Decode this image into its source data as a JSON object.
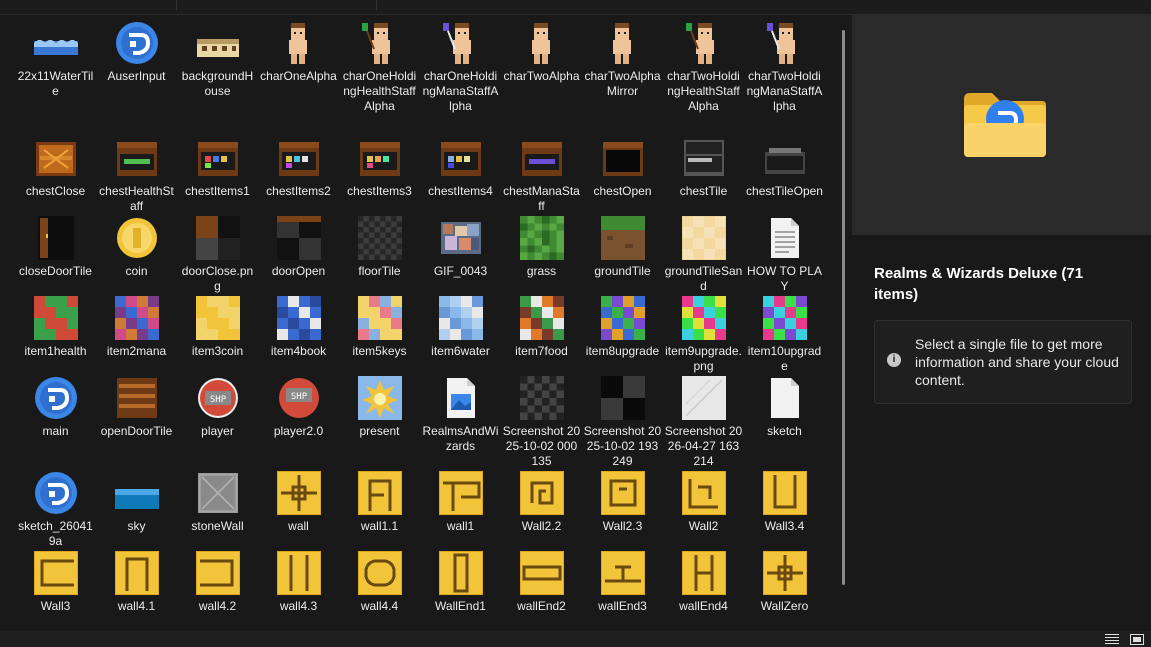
{
  "details": {
    "title": "Realms & Wizards Deluxe (71 items)",
    "info_message": "Select a single file to get more information and share your cloud content.",
    "info_icon": "i"
  },
  "files": [
    {
      "name": "22x11WaterTile",
      "icon": "water-tile-icon"
    },
    {
      "name": "AuserInput",
      "icon": "app-blue-icon"
    },
    {
      "name": "backgroundHouse",
      "icon": "house-icon"
    },
    {
      "name": "charOneAlpha",
      "icon": "character-icon"
    },
    {
      "name": "charOneHoldingHealthStaffAlpha",
      "icon": "character-health-staff-icon"
    },
    {
      "name": "charOneHoldingManaStaffAlpha",
      "icon": "character-mana-staff-icon"
    },
    {
      "name": "charTwoAlpha",
      "icon": "character-icon"
    },
    {
      "name": "charTwoAlphaMirror",
      "icon": "character-icon"
    },
    {
      "name": "charTwoHoldingHealthStaffAlpha",
      "icon": "character-health-staff-icon"
    },
    {
      "name": "charTwoHoldingManaStaffAlpha",
      "icon": "character-mana-staff-icon"
    },
    {
      "name": "chestClose",
      "icon": "chest-closed-icon"
    },
    {
      "name": "chestHealthStaff",
      "icon": "chest-health-icon"
    },
    {
      "name": "chestItems1",
      "icon": "chest-items-icon"
    },
    {
      "name": "chestItems2",
      "icon": "chest-items-icon"
    },
    {
      "name": "chestItems3",
      "icon": "chest-items-icon"
    },
    {
      "name": "chestItems4",
      "icon": "chest-items-icon"
    },
    {
      "name": "chestManaStaff",
      "icon": "chest-mana-icon"
    },
    {
      "name": "chestOpen",
      "icon": "chest-open-icon"
    },
    {
      "name": "chestTile",
      "icon": "chest-tile-icon"
    },
    {
      "name": "chestTileOpen",
      "icon": "chest-tile-open-icon"
    },
    {
      "name": "closeDoorTile",
      "icon": "door-closed-icon"
    },
    {
      "name": "coin",
      "icon": "coin-icon"
    },
    {
      "name": "doorClose.png",
      "icon": "door-tile-icon"
    },
    {
      "name": "doorOpen",
      "icon": "door-open-icon"
    },
    {
      "name": "floorTile",
      "icon": "checker-icon"
    },
    {
      "name": "GIF_0043",
      "icon": "photo-icon"
    },
    {
      "name": "grass",
      "icon": "grass-icon"
    },
    {
      "name": "groundTile",
      "icon": "ground-icon"
    },
    {
      "name": "groundTileSand",
      "icon": "sand-icon"
    },
    {
      "name": "HOW TO PLAY",
      "icon": "text-document-icon"
    },
    {
      "name": "item1health",
      "icon": "item-grid-icon"
    },
    {
      "name": "item2mana",
      "icon": "item-grid-icon"
    },
    {
      "name": "item3coin",
      "icon": "item-grid-icon"
    },
    {
      "name": "item4book",
      "icon": "item-grid-icon"
    },
    {
      "name": "item5keys",
      "icon": "item-grid-icon"
    },
    {
      "name": "item6water",
      "icon": "item-grid-icon"
    },
    {
      "name": "item7food",
      "icon": "item-grid-icon"
    },
    {
      "name": "item8upgrade",
      "icon": "item-grid-icon"
    },
    {
      "name": "item9upgrade.png",
      "icon": "item-grid-icon"
    },
    {
      "name": "item10upgrade",
      "icon": "item-grid-icon"
    },
    {
      "name": "main",
      "icon": "app-blue-icon"
    },
    {
      "name": "openDoorTile",
      "icon": "door-open-tile-icon"
    },
    {
      "name": "player",
      "icon": "player-icon"
    },
    {
      "name": "player2.0",
      "icon": "player2-icon"
    },
    {
      "name": "present",
      "icon": "present-icon"
    },
    {
      "name": "RealmsAndWizards",
      "icon": "image-file-icon"
    },
    {
      "name": "Screenshot 2025-10-02 000135",
      "icon": "screenshot-checker-icon"
    },
    {
      "name": "Screenshot 2025-10-02 193249",
      "icon": "screenshot-blocks-icon"
    },
    {
      "name": "Screenshot 2026-04-27 163214",
      "icon": "screenshot-light-icon"
    },
    {
      "name": "sketch",
      "icon": "blank-document-icon"
    },
    {
      "name": "sketch_260419a",
      "icon": "app-blue-icon"
    },
    {
      "name": "sky",
      "icon": "sky-icon"
    },
    {
      "name": "stoneWall",
      "icon": "stone-wall-icon"
    },
    {
      "name": "wall",
      "icon": "wall-icon"
    },
    {
      "name": "wall1.1",
      "icon": "wall-icon"
    },
    {
      "name": "wall1",
      "icon": "wall-icon"
    },
    {
      "name": "Wall2.2",
      "icon": "wall-icon"
    },
    {
      "name": "Wall2.3",
      "icon": "wall-icon"
    },
    {
      "name": "Wall2",
      "icon": "wall-icon"
    },
    {
      "name": "Wall3.4",
      "icon": "wall-icon"
    },
    {
      "name": "Wall3",
      "icon": "wall-icon"
    },
    {
      "name": "wall4.1",
      "icon": "wall-icon"
    },
    {
      "name": "wall4.2",
      "icon": "wall-icon"
    },
    {
      "name": "wall4.3",
      "icon": "wall-icon"
    },
    {
      "name": "wall4.4",
      "icon": "wall-icon"
    },
    {
      "name": "WallEnd1",
      "icon": "wall-icon"
    },
    {
      "name": "wallEnd2",
      "icon": "wall-icon"
    },
    {
      "name": "wallEnd3",
      "icon": "wall-icon"
    },
    {
      "name": "wallEnd4",
      "icon": "wall-icon"
    },
    {
      "name": "WallZero",
      "icon": "wall-icon"
    },
    {
      "name": "",
      "icon": "water-tile-icon"
    }
  ],
  "colors": {
    "background": "#191919",
    "preview_bg": "#2a2a2a",
    "app_blue": "#2f80ed",
    "wall_yellow": "#f2c43a",
    "folder_yellow": "#f7c948"
  },
  "statusbar": {
    "details_view_icon": "details-view-icon",
    "tiles_view_icon": "large-icons-view-icon"
  }
}
